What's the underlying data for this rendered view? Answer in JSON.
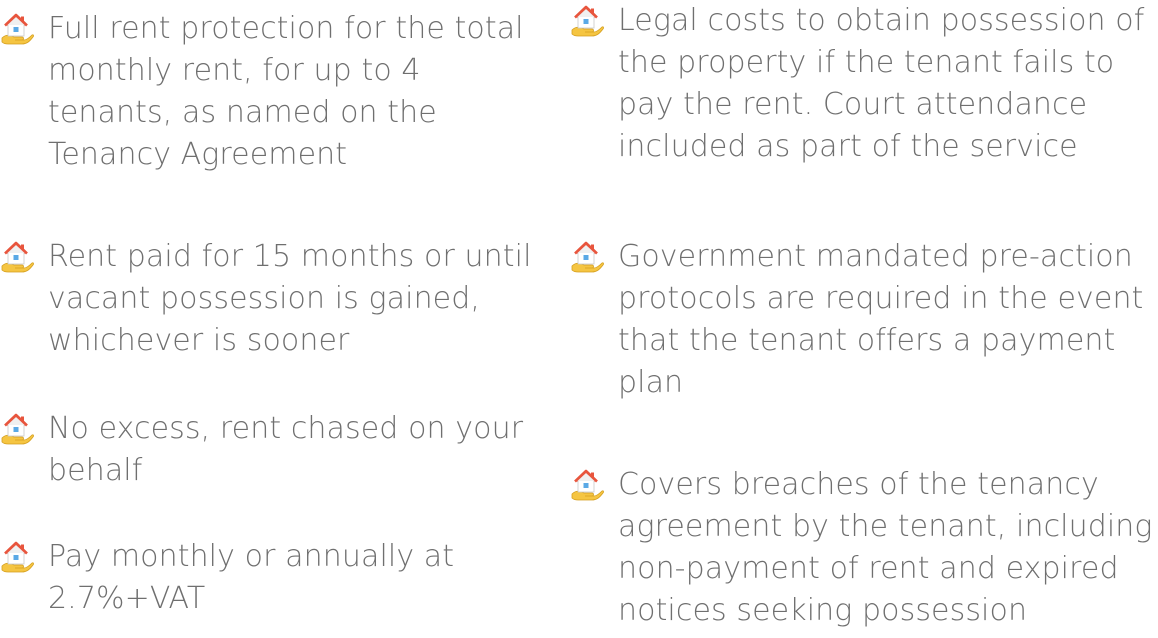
{
  "benefits_left": [
    {
      "text": "Full rent protection for the total monthly rent, for up to 4 tenants, as named on the Tenancy Agreement",
      "icon": "house-in-hand-icon"
    },
    {
      "text": "Rent paid for 15 months or until vacant possession is gained, whichever is sooner",
      "icon": "house-in-hand-icon"
    },
    {
      "text": "No excess, rent chased on your behalf",
      "icon": "house-in-hand-icon"
    },
    {
      "text": "Pay monthly or annually at 2.7%+VAT",
      "icon": "house-in-hand-icon"
    }
  ],
  "benefits_right": [
    {
      "text": "Legal costs to obtain possession of the property if the tenant fails to pay the rent. Court attendance included as part of the service",
      "icon": "house-in-hand-icon"
    },
    {
      "text": "Government mandated pre-action protocols are required in the event that the tenant offers a payment plan",
      "icon": "house-in-hand-icon"
    },
    {
      "text": "Covers breaches of the tenancy agreement by the tenant, including non-payment of rent and expired notices seeking possession",
      "icon": "house-in-hand-icon"
    }
  ],
  "colors": {
    "text": "#6f6f6f",
    "roof": "#e8553d",
    "house": "#ffffff",
    "hand": "#f5c542",
    "window": "#5aa9e6"
  }
}
